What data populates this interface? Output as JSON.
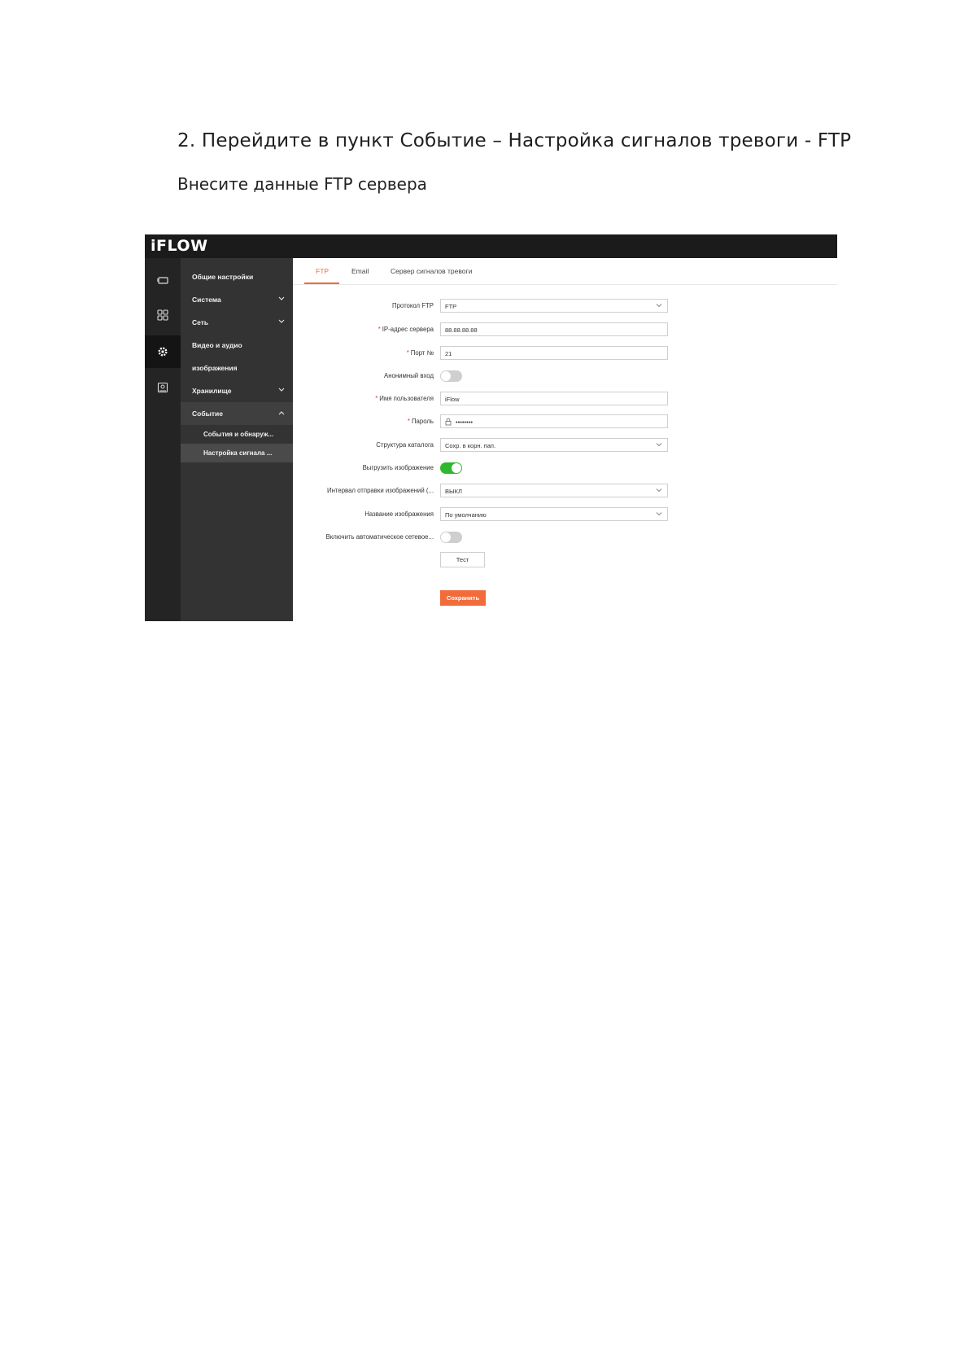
{
  "document": {
    "heading": "2. Перейдите в пункт Событие – Настройка сигналов тревоги - FTP",
    "subheading": "Внесите данные FTP сервера"
  },
  "app": {
    "logo": "iFLOW",
    "sidebar": {
      "items": [
        {
          "label": "Общие настройки",
          "has_chevron": false
        },
        {
          "label": "Система",
          "has_chevron": true
        },
        {
          "label": "Сеть",
          "has_chevron": true
        },
        {
          "label": "Видео и аудио",
          "has_chevron": false
        },
        {
          "label": "изображения",
          "has_chevron": false
        },
        {
          "label": "Хранилище",
          "has_chevron": true
        },
        {
          "label": "Событие",
          "has_chevron": true,
          "expanded": true
        }
      ],
      "subitems": [
        {
          "label": "События и обнаруж..."
        },
        {
          "label": "Настройка сигнала ..."
        }
      ]
    },
    "tabs": [
      "FTP",
      "Email",
      "Сервер сигналов тревоги"
    ],
    "active_tab": "FTP",
    "form": {
      "protocol": {
        "label": "Протокол FTP",
        "value": "FTP"
      },
      "server_ip": {
        "label": "IP-адрес сервера",
        "value": "88.88.88.88",
        "required": true
      },
      "port": {
        "label": "Порт №",
        "value": "21",
        "required": true
      },
      "anonymous": {
        "label": "Анонимный вход",
        "on": false
      },
      "username": {
        "label": "Имя пользователя",
        "value": "iFlow",
        "required": true
      },
      "password": {
        "label": "Пароль",
        "value": "••••••••",
        "required": true
      },
      "dir_structure": {
        "label": "Структура каталога",
        "value": "Сохр. в корн. пап."
      },
      "upload_image": {
        "label": "Выгрузить изображение",
        "on": true
      },
      "upload_interval": {
        "label": "Интервал отправки изображений (...",
        "value": "ВЫКЛ"
      },
      "image_name": {
        "label": "Название изображения",
        "value": "По умолчанию"
      },
      "auto_network": {
        "label": "Включить автоматическое сетевое...",
        "on": false
      }
    },
    "buttons": {
      "test": "Тест",
      "save": "Сохранить"
    },
    "colors": {
      "accent": "#f26b3a",
      "toggle_on": "#2db92d",
      "topbar": "#1b1b1b",
      "sidebar": "#333333"
    }
  }
}
